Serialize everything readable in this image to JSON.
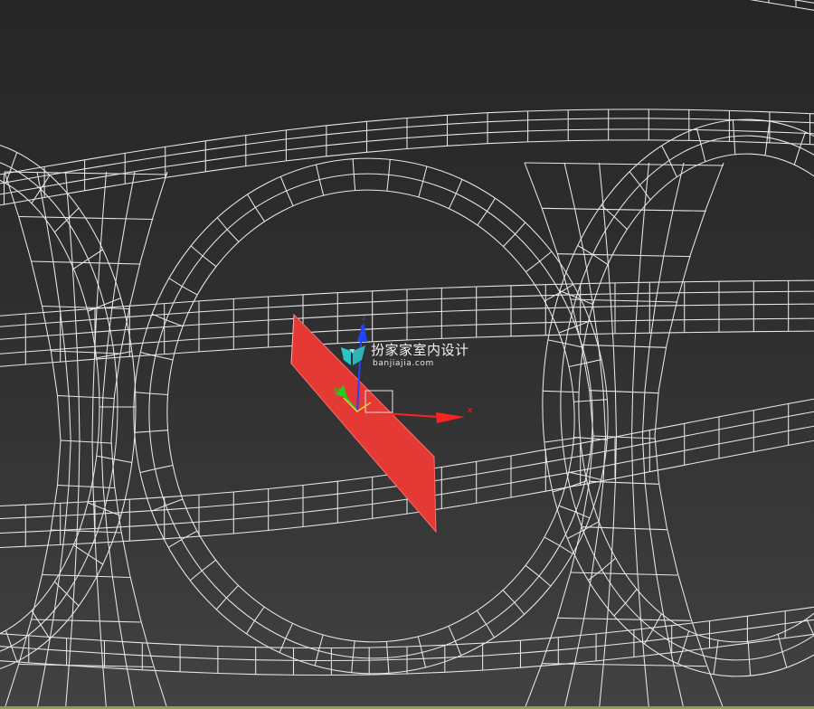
{
  "viewport": {
    "mode": "wireframe",
    "background_top": "#262626",
    "background_bottom": "#424242",
    "wire_color": "#e8e8e8"
  },
  "selection": {
    "object": "plane",
    "color": "#e53935"
  },
  "gizmo": {
    "type": "move-transform-gizmo",
    "x_color": "#ff2222",
    "y_color": "#22cc22",
    "z_color": "#2244ff",
    "axis_labels": {
      "x": "x",
      "y": "y",
      "z": "z"
    }
  },
  "watermark": {
    "logo_icon": "fan-logo-icon",
    "text_cn": "扮家家室内设计",
    "url": "banjiajia.com"
  }
}
